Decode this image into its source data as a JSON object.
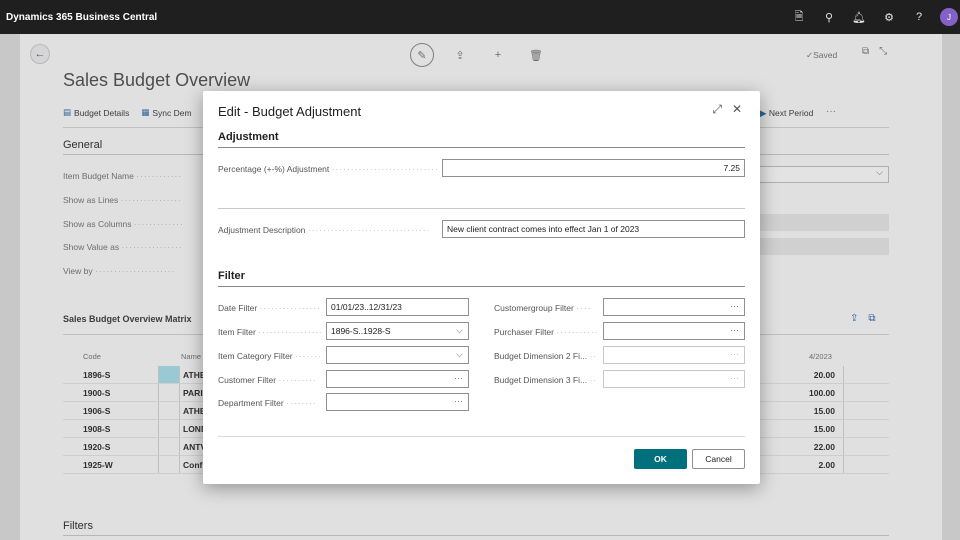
{
  "app": {
    "title": "Dynamics 365 Business Central",
    "user_initial": "J"
  },
  "page": {
    "title": "Sales Budget Overview",
    "saved_label": "Saved",
    "actions": [
      "Budget Details",
      "Sync Dem"
    ],
    "next_period": "Next Period",
    "more": "···",
    "general_header": "General",
    "general_fields": [
      "Item Budget Name",
      "Show as Lines",
      "Show as Columns",
      "Show Value as",
      "View by"
    ],
    "matrix_title": "Sales Budget Overview Matrix",
    "col_code": "Code",
    "col_name": "Name",
    "col_period": "4/2023",
    "rows": [
      {
        "code": "1896-S",
        "name": "ATHE",
        "value": "20.00"
      },
      {
        "code": "1900-S",
        "name": "PARI",
        "value": "100.00"
      },
      {
        "code": "1906-S",
        "name": "ATHE",
        "value": "15.00"
      },
      {
        "code": "1908-S",
        "name": "LOND",
        "value": "15.00"
      },
      {
        "code": "1920-S",
        "name": "ANTV",
        "value": "22.00"
      },
      {
        "code": "1925-W",
        "name": "Conf",
        "value": "2.00"
      }
    ],
    "filters_header": "Filters"
  },
  "dialog": {
    "title": "Edit - Budget Adjustment",
    "adjustment_header": "Adjustment",
    "percentage_label": "Percentage (+-%) Adjustment",
    "percentage_value": "7.25",
    "description_label": "Adjustment Description",
    "description_value": "New client contract comes into effect Jan 1 of 2023",
    "filter_header": "Filter",
    "date_filter_label": "Date Filter",
    "date_filter_value": "01/01/23..12/31/23",
    "item_filter_label": "Item Filter",
    "item_filter_value": "1896-S..1928-S",
    "item_category_filter_label": "Item Category Filter",
    "customer_filter_label": "Customer Filter",
    "department_filter_label": "Department Filter",
    "customergroup_filter_label": "Customergroup Filter",
    "purchaser_filter_label": "Purchaser Filter",
    "budget_dim2_label": "Budget Dimension 2 Fi...",
    "budget_dim3_label": "Budget Dimension 3 Fi...",
    "ellipsis": "···",
    "ok_label": "OK",
    "cancel_label": "Cancel"
  }
}
